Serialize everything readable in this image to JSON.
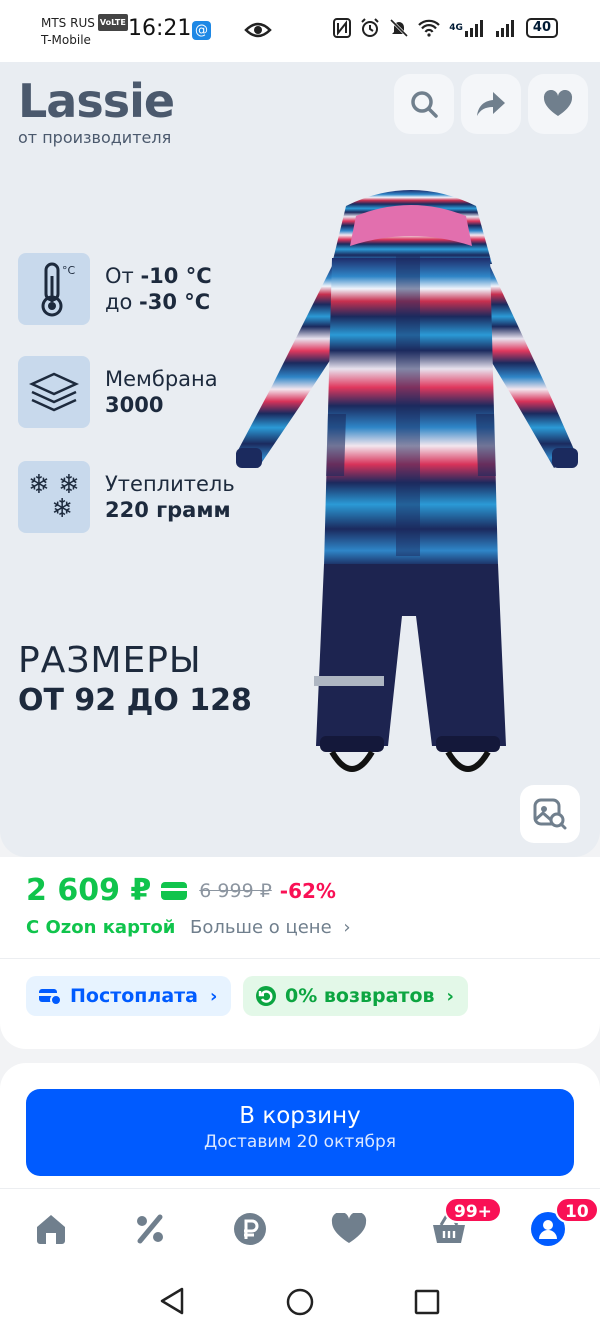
{
  "status_bar": {
    "carrier_1": "MTS RUS",
    "volte": "VoLTE",
    "carrier_2": "T-Mobile",
    "time": "16:21",
    "network": "4G",
    "battery": "40"
  },
  "hero": {
    "brand": "Lassie",
    "brand_sub": "от производителя",
    "features": [
      {
        "icon": "thermometer-icon",
        "line1_a": "От ",
        "line1_b": "-10 °C",
        "line2_a": "до ",
        "line2_b": "-30 °C"
      },
      {
        "icon": "membrane-icon",
        "line1": "Мембрана",
        "line2": "3000"
      },
      {
        "icon": "snowflakes-icon",
        "line1": "Утеплитель",
        "line2": "220 грамм"
      }
    ],
    "sizes_title": "РАЗМЕРЫ",
    "sizes_range": "ОТ 92 ДО 128"
  },
  "price": {
    "current": "2 609 ₽",
    "old": "6 999 ₽",
    "discount": "-62%",
    "ozon_card": "С Ozon картой",
    "more_price": "Больше о цене"
  },
  "chips": {
    "postpay": "Постоплата",
    "returns": "0% возвратов"
  },
  "cart": {
    "label": "В корзину",
    "delivery": "Доставим 20 октября"
  },
  "tabbar": {
    "cart_badge": "99+",
    "profile_badge": "10"
  },
  "colors": {
    "accent": "#005bff",
    "price_green": "#10c44c",
    "discount_pink": "#f91155"
  }
}
